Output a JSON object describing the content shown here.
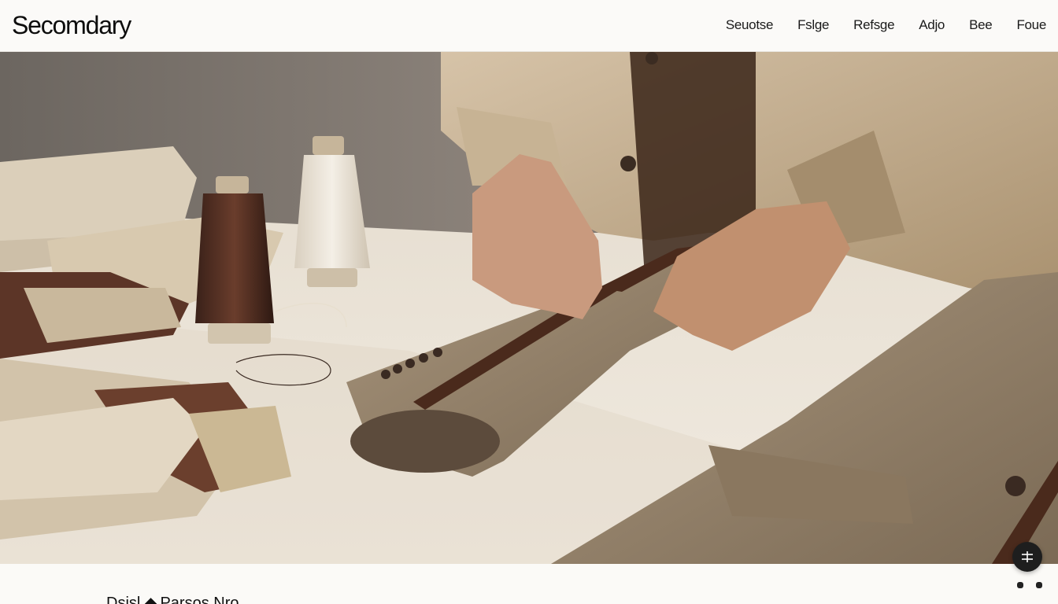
{
  "brand": {
    "name": "Secomdary"
  },
  "nav": {
    "items": [
      {
        "label": "Seuotse"
      },
      {
        "label": "Fslge"
      },
      {
        "label": "Refsge"
      },
      {
        "label": "Adjo"
      },
      {
        "label": "Bee"
      },
      {
        "label": "Foue"
      }
    ]
  },
  "hero": {
    "icon": "tailoring-photo"
  },
  "fab": {
    "icon": "adjust-icon"
  },
  "pager": {
    "count": 2
  },
  "footer": {
    "heading_left": "Dsisl",
    "heading_right": "Parsos Nro"
  },
  "colors": {
    "dark_brown": "#4a2a1c",
    "tweed": "#8d7a62",
    "cream": "#efe6d6"
  }
}
